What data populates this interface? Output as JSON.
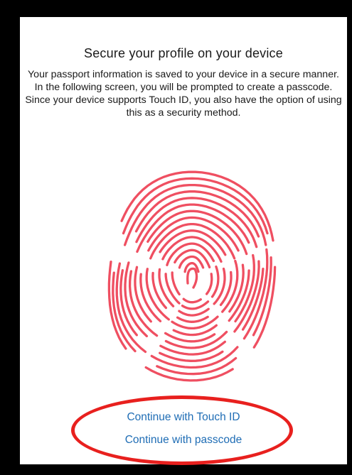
{
  "screen": {
    "title": "Secure your profile on your device",
    "description": "Your passport information is saved to your device in a secure manner. In the following screen, you will be prompted to create a passcode. Since your device supports Touch ID, you also have the option of using this as a security method."
  },
  "actions": {
    "touch_id_label": "Continue with Touch ID",
    "passcode_label": "Continue with passcode"
  },
  "icons": {
    "fingerprint": "fingerprint-icon"
  },
  "colors": {
    "fingerprint": "#ef4f61",
    "link": "#1f6db5",
    "highlight": "#e8201e"
  }
}
